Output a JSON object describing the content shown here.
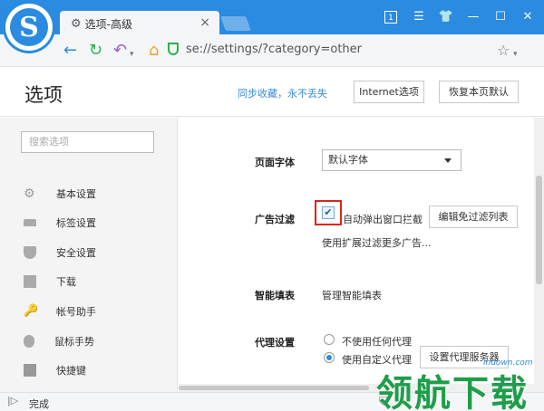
{
  "tab": {
    "title": "选项-高级"
  },
  "address": {
    "url": "se://settings/?category=other"
  },
  "header": {
    "title": "选项",
    "sync_link": "同步收藏，永不丢失",
    "internet_button": "Internet选项",
    "restore_button": "恢复本页默认"
  },
  "sidebar": {
    "search_placeholder": "搜索选项",
    "items": [
      {
        "label": "基本设置",
        "icon": "gear-icon"
      },
      {
        "label": "标签设置",
        "icon": "tab-icon"
      },
      {
        "label": "安全设置",
        "icon": "shield-icon"
      },
      {
        "label": "下载",
        "icon": "download-icon"
      },
      {
        "label": "帐号助手",
        "icon": "key-icon"
      },
      {
        "label": "鼠标手势",
        "icon": "mouse-icon"
      },
      {
        "label": "快捷键",
        "icon": "shortcut-icon"
      }
    ]
  },
  "settings": {
    "font": {
      "label": "页面字体",
      "value": "默认字体"
    },
    "adblock": {
      "label": "广告过滤",
      "checkbox_label": "自动弹出窗口拦截",
      "checked": true,
      "edit_button": "编辑免过滤列表",
      "hint": "使用扩展过滤更多广告..."
    },
    "autofill": {
      "label": "智能填表",
      "link": "管理智能填表"
    },
    "proxy": {
      "label": "代理设置",
      "option_none": "不使用任何代理",
      "option_custom": "使用自定义代理",
      "selected": "custom",
      "setup_button": "设置代理服务器"
    }
  },
  "status": {
    "text": "完成"
  },
  "watermark": {
    "text": "领航下载",
    "url": "lhdown.com"
  },
  "colors": {
    "brand": "#2a8be0",
    "highlight": "#d8261c",
    "watermark": "#1e9e4a"
  }
}
